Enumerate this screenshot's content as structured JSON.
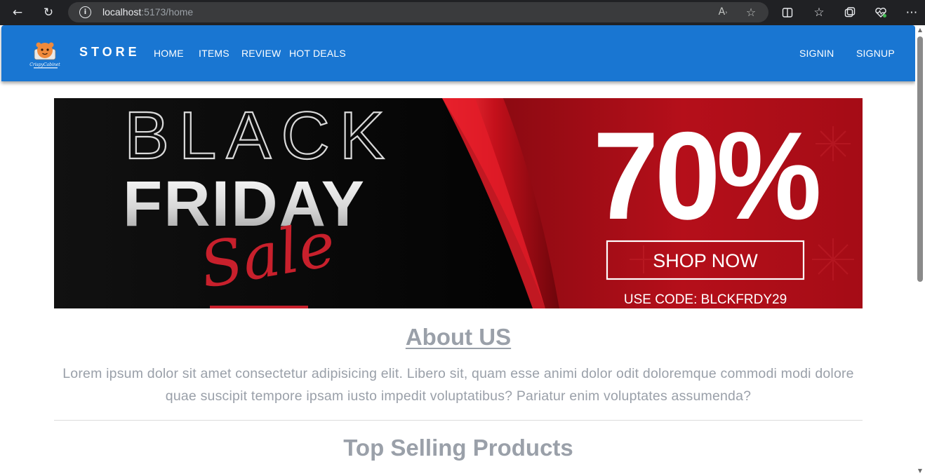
{
  "browser": {
    "url_host": "localhost",
    "url_rest": ":5173/home",
    "icons": {
      "back": "arrow-left-icon",
      "refresh": "refresh-icon",
      "info": "info-icon",
      "read_aloud": "read-aloud-icon",
      "favorite": "star-icon",
      "split": "split-screen-icon",
      "favorites": "favorites-icon",
      "collections": "collections-icon",
      "health": "browser-essentials-icon",
      "more": "more-icon"
    }
  },
  "navbar": {
    "brand": "STORE",
    "logo_text": "CrispyCabinet",
    "links": [
      "HOME",
      "ITEMS",
      "REVIEW",
      "HOT DEALS"
    ],
    "auth": [
      "SIGNIN",
      "SIGNUP"
    ],
    "color": "#1976d2"
  },
  "banner": {
    "line1": "BLACK",
    "line2": "FRIDAY",
    "script": "Sale",
    "discount": "70%",
    "cta": "SHOP NOW",
    "code": "USE CODE: BLCKFRDY29",
    "colors": {
      "black": "#050505",
      "red": "#b30f1a"
    }
  },
  "about": {
    "title": "About US",
    "text": "Lorem ipsum dolor sit amet consectetur adipisicing elit. Libero sit, quam esse animi dolor odit doloremque commodi modi dolore quae suscipit tempore ipsam iusto impedit voluptatibus? Pariatur enim voluptates assumenda?"
  },
  "top_selling": {
    "title": "Top Selling Products"
  }
}
